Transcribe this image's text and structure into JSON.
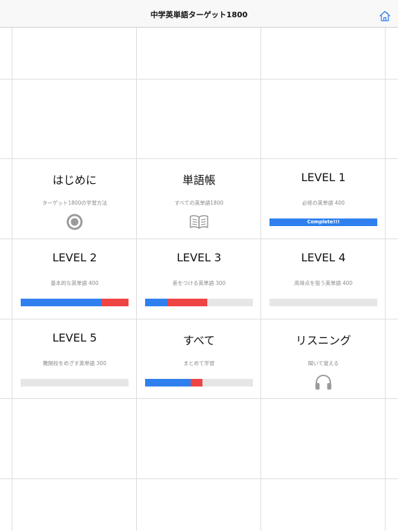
{
  "nav": {
    "title": "中学英単語ターゲット1800",
    "home_icon": "home-icon"
  },
  "colors": {
    "progress_blue": "#2f80ee",
    "progress_red": "#ee4444",
    "progress_track": "#e6e6e6"
  },
  "menu": [
    {
      "id": "intro",
      "title": "はじめに",
      "subtitle": "ターゲット1800の学習方法",
      "icon": "target-icon"
    },
    {
      "id": "wordbook",
      "title": "単語帳",
      "subtitle": "すべての英単語1800",
      "icon": "book-icon"
    },
    {
      "id": "level1",
      "title": "LEVEL 1",
      "subtitle": "必修の英単語 400",
      "progress": {
        "complete": true,
        "label": "Complete!!!"
      }
    },
    {
      "id": "level2",
      "title": "LEVEL 2",
      "subtitle": "基本的な英単語 400",
      "progress": {
        "blue": 0.75,
        "red": 0.25
      }
    },
    {
      "id": "level3",
      "title": "LEVEL 3",
      "subtitle": "差をつける英単語 300",
      "progress": {
        "blue": 0.21,
        "red": 0.37
      }
    },
    {
      "id": "level4",
      "title": "LEVEL 4",
      "subtitle": "高得点を狙う英単語 400",
      "progress": {
        "blue": 0,
        "red": 0
      }
    },
    {
      "id": "level5",
      "title": "LEVEL 5",
      "subtitle": "難関校をめざす英単語 300",
      "progress": {
        "blue": 0,
        "red": 0
      }
    },
    {
      "id": "all",
      "title": "すべて",
      "subtitle": "まとめて学習",
      "progress": {
        "blue": 0.42,
        "red": 0.11
      }
    },
    {
      "id": "listening",
      "title": "リスニング",
      "subtitle": "聞いて覚える",
      "icon": "headphones-icon"
    }
  ]
}
